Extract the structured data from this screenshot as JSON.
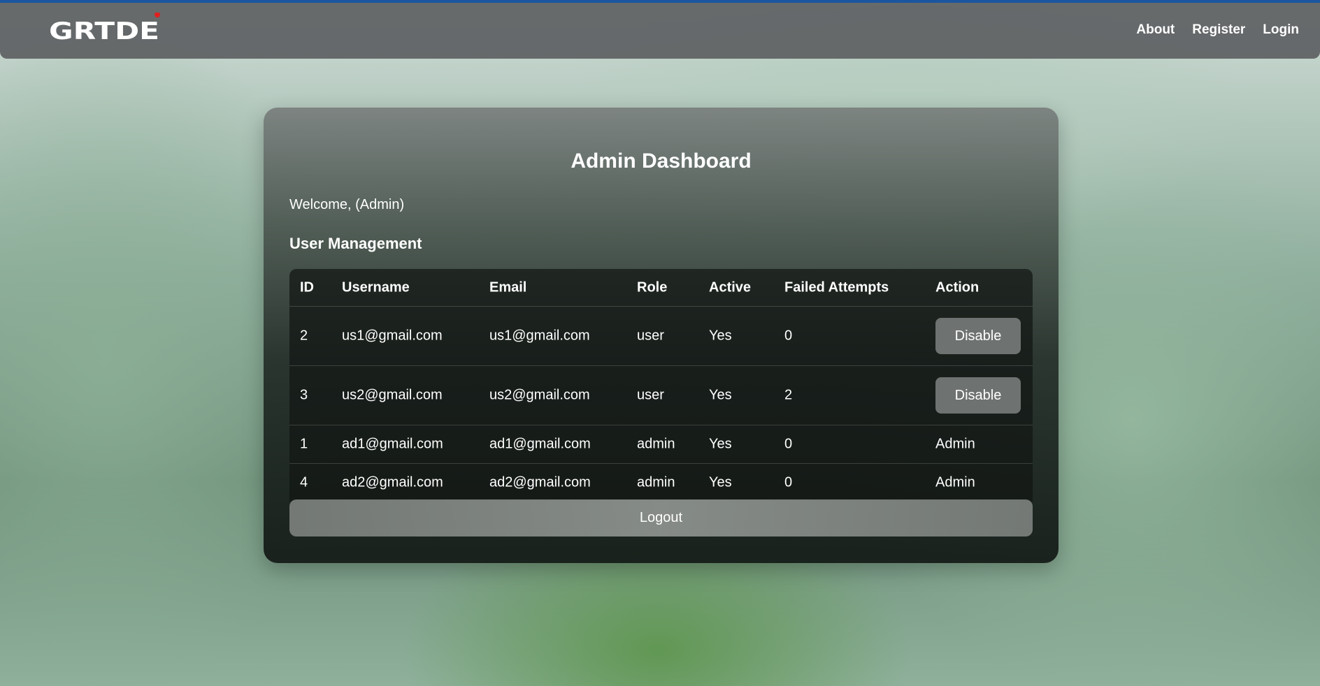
{
  "nav": {
    "logo_text": "GRTDE",
    "links": [
      "About",
      "Register",
      "Login"
    ]
  },
  "dashboard": {
    "title": "Admin Dashboard",
    "welcome": "Welcome, (Admin)",
    "section_title": "User Management",
    "logout_label": "Logout"
  },
  "table": {
    "headers": [
      "ID",
      "Username",
      "Email",
      "Role",
      "Active",
      "Failed Attempts",
      "Action"
    ],
    "rows": [
      {
        "id": "2",
        "username": "us1@gmail.com",
        "email": "us1@gmail.com",
        "role": "user",
        "active": "Yes",
        "failed": "0",
        "action": "Disable"
      },
      {
        "id": "3",
        "username": "us2@gmail.com",
        "email": "us2@gmail.com",
        "role": "user",
        "active": "Yes",
        "failed": "2",
        "action": "Disable"
      },
      {
        "id": "1",
        "username": "ad1@gmail.com",
        "email": "ad1@gmail.com",
        "role": "admin",
        "active": "Yes",
        "failed": "0",
        "action": "Admin"
      },
      {
        "id": "4",
        "username": "ad2@gmail.com",
        "email": "ad2@gmail.com",
        "role": "admin",
        "active": "Yes",
        "failed": "0",
        "action": "Admin"
      }
    ]
  },
  "colors": {
    "topline": "#1a56a0",
    "navbar": "#5f6163",
    "button": "#6e7270",
    "logo_dot": "#e02020"
  }
}
